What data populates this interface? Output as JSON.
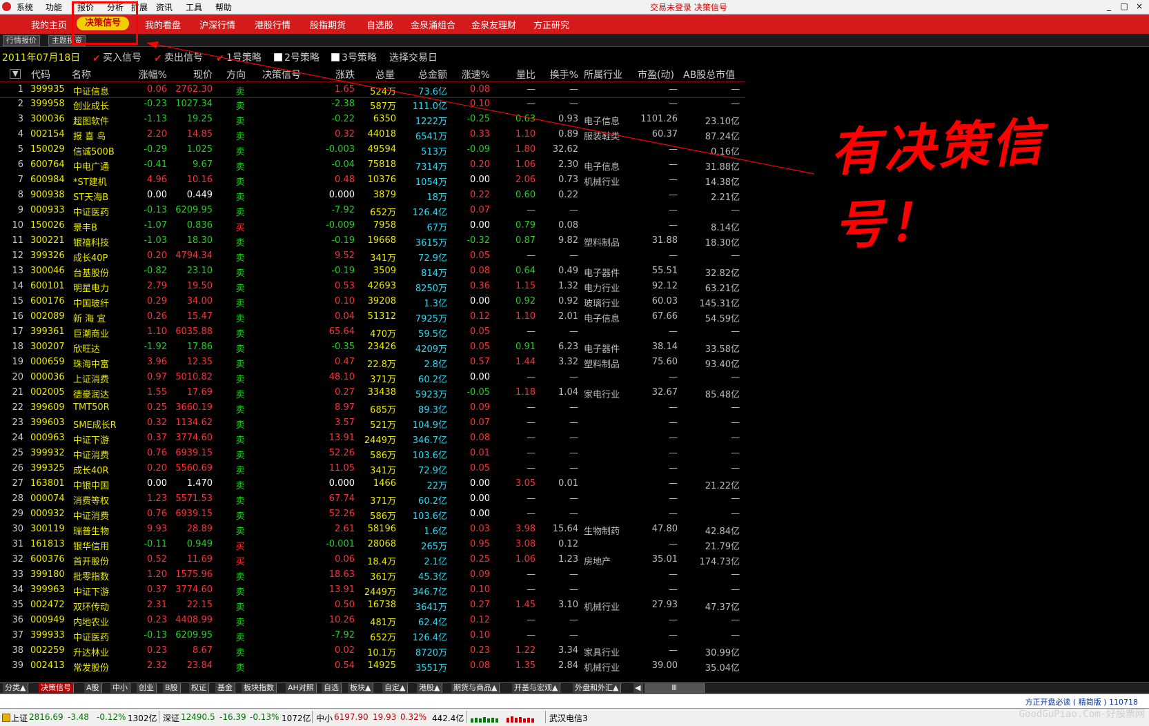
{
  "menubar": {
    "items": [
      "系统",
      "功能",
      "报价",
      "分析",
      "扩展",
      "资讯",
      "工具",
      "帮助"
    ],
    "status": "交易未登录  决策信号",
    "win_buttons": [
      "_",
      "□",
      "×"
    ]
  },
  "navbar": {
    "items": [
      "我的主页",
      "决策信号",
      "我的看盘",
      "沪深行情",
      "港股行情",
      "股指期货",
      "自选股",
      "金泉涌组合",
      "金泉友理财",
      "方正研究"
    ],
    "active_index": 1
  },
  "subtabs": [
    "行情报价",
    "主题投资"
  ],
  "filter": {
    "date": "2011年07月18日",
    "options": [
      {
        "label": "买入信号",
        "checked": true
      },
      {
        "label": "卖出信号",
        "checked": true
      },
      {
        "label": "1号策略",
        "checked": true
      },
      {
        "label": "2号策略",
        "checked": false
      },
      {
        "label": "3号策略",
        "checked": false
      }
    ],
    "select_day": "选择交易日"
  },
  "table": {
    "headers": [
      "代码",
      "名称",
      "涨幅%",
      "现价",
      "方向",
      "决策信号",
      "涨跌",
      "总量",
      "总金额",
      "涨速%",
      "量比",
      "换手%",
      "所属行业",
      "市盈(动)",
      "AB股总市值"
    ],
    "sort_icon": "▼",
    "rows": [
      [
        "1",
        "399935",
        "中证信息",
        "0.06",
        "2762.30",
        "卖",
        "",
        "1.65",
        "524万",
        "73.6亿",
        "0.08",
        "—",
        "—",
        "",
        "—",
        "—"
      ],
      [
        "2",
        "399958",
        "创业成长",
        "-0.23",
        "1027.34",
        "卖",
        "",
        "-2.38",
        "587万",
        "111.0亿",
        "0.10",
        "—",
        "—",
        "",
        "—",
        "—"
      ],
      [
        "3",
        "300036",
        "超图软件",
        "-1.13",
        "19.25",
        "卖",
        "",
        "-0.22",
        "6350",
        "1222万",
        "-0.25",
        "0.63",
        "0.93",
        "电子信息",
        "1101.26",
        "23.10亿"
      ],
      [
        "4",
        "002154",
        "报 喜 鸟",
        "2.20",
        "14.85",
        "卖",
        "",
        "0.32",
        "44018",
        "6541万",
        "0.33",
        "1.10",
        "0.89",
        "服装鞋类",
        "60.37",
        "87.24亿"
      ],
      [
        "5",
        "150029",
        "信诚500B",
        "-0.29",
        "1.025",
        "卖",
        "",
        "-0.003",
        "49594",
        "513万",
        "-0.09",
        "1.80",
        "32.62",
        "",
        "—",
        "0.16亿"
      ],
      [
        "6",
        "600764",
        "中电广通",
        "-0.41",
        "9.67",
        "卖",
        "",
        "-0.04",
        "75818",
        "7314万",
        "0.20",
        "1.06",
        "2.30",
        "电子信息",
        "—",
        "31.88亿"
      ],
      [
        "7",
        "600984",
        "*ST建机",
        "4.96",
        "10.16",
        "卖",
        "",
        "0.48",
        "10376",
        "1054万",
        "0.00",
        "2.06",
        "0.73",
        "机械行业",
        "—",
        "14.38亿"
      ],
      [
        "8",
        "900938",
        "ST天海B",
        "0.00",
        "0.449",
        "卖",
        "",
        "0.000",
        "3879",
        "18万",
        "0.22",
        "0.60",
        "0.22",
        "",
        "—",
        "2.21亿"
      ],
      [
        "9",
        "000933",
        "中证医药",
        "-0.13",
        "6209.95",
        "卖",
        "",
        "-7.92",
        "652万",
        "126.4亿",
        "0.07",
        "—",
        "—",
        "",
        "—",
        "—"
      ],
      [
        "10",
        "150026",
        "景丰B",
        "-1.07",
        "0.836",
        "买",
        "",
        "-0.009",
        "7958",
        "67万",
        "0.00",
        "0.79",
        "0.08",
        "",
        "—",
        "8.14亿"
      ],
      [
        "11",
        "300221",
        "银禧科技",
        "-1.03",
        "18.30",
        "卖",
        "",
        "-0.19",
        "19668",
        "3615万",
        "-0.32",
        "0.87",
        "9.82",
        "塑料制品",
        "31.88",
        "18.30亿"
      ],
      [
        "12",
        "399326",
        "成长40P",
        "0.20",
        "4794.34",
        "卖",
        "",
        "9.52",
        "341万",
        "72.9亿",
        "0.05",
        "—",
        "—",
        "",
        "—",
        "—"
      ],
      [
        "13",
        "300046",
        "台基股份",
        "-0.82",
        "23.10",
        "卖",
        "",
        "-0.19",
        "3509",
        "814万",
        "0.08",
        "0.64",
        "0.49",
        "电子器件",
        "55.51",
        "32.82亿"
      ],
      [
        "14",
        "600101",
        "明星电力",
        "2.79",
        "19.50",
        "卖",
        "",
        "0.53",
        "42693",
        "8250万",
        "0.36",
        "1.15",
        "1.32",
        "电力行业",
        "92.12",
        "63.21亿"
      ],
      [
        "15",
        "600176",
        "中国玻纤",
        "0.29",
        "34.00",
        "卖",
        "",
        "0.10",
        "39208",
        "1.3亿",
        "0.00",
        "0.92",
        "0.92",
        "玻璃行业",
        "60.03",
        "145.31亿"
      ],
      [
        "16",
        "002089",
        "新 海 宜",
        "0.26",
        "15.47",
        "卖",
        "",
        "0.04",
        "51312",
        "7925万",
        "0.12",
        "1.10",
        "2.01",
        "电子信息",
        "67.66",
        "54.59亿"
      ],
      [
        "17",
        "399361",
        "巨潮商业",
        "1.10",
        "6035.88",
        "卖",
        "",
        "65.64",
        "470万",
        "59.5亿",
        "0.05",
        "—",
        "—",
        "",
        "—",
        "—"
      ],
      [
        "18",
        "300207",
        "欣旺达",
        "-1.92",
        "17.86",
        "卖",
        "",
        "-0.35",
        "23426",
        "4209万",
        "0.05",
        "0.91",
        "6.23",
        "电子器件",
        "38.14",
        "33.58亿"
      ],
      [
        "19",
        "000659",
        "珠海中富",
        "3.96",
        "12.35",
        "卖",
        "",
        "0.47",
        "22.8万",
        "2.8亿",
        "0.57",
        "1.44",
        "3.32",
        "塑料制品",
        "75.60",
        "93.40亿"
      ],
      [
        "20",
        "000036",
        "上证消费",
        "0.97",
        "5010.82",
        "卖",
        "",
        "48.10",
        "371万",
        "60.2亿",
        "0.00",
        "—",
        "—",
        "",
        "—",
        "—"
      ],
      [
        "21",
        "002005",
        "德豪润达",
        "1.55",
        "17.69",
        "卖",
        "",
        "0.27",
        "33438",
        "5923万",
        "-0.05",
        "1.18",
        "1.04",
        "家电行业",
        "32.67",
        "85.48亿"
      ],
      [
        "22",
        "399609",
        "TMT50R",
        "0.25",
        "3660.19",
        "卖",
        "",
        "8.97",
        "685万",
        "89.3亿",
        "0.09",
        "—",
        "—",
        "",
        "—",
        "—"
      ],
      [
        "23",
        "399603",
        "SME成长R",
        "0.32",
        "1134.62",
        "卖",
        "",
        "3.57",
        "521万",
        "104.9亿",
        "0.07",
        "—",
        "—",
        "",
        "—",
        "—"
      ],
      [
        "24",
        "000963",
        "中证下游",
        "0.37",
        "3774.60",
        "卖",
        "",
        "13.91",
        "2449万",
        "346.7亿",
        "0.08",
        "—",
        "—",
        "",
        "—",
        "—"
      ],
      [
        "25",
        "399932",
        "中证消费",
        "0.76",
        "6939.15",
        "卖",
        "",
        "52.26",
        "586万",
        "103.6亿",
        "0.01",
        "—",
        "—",
        "",
        "—",
        "—"
      ],
      [
        "26",
        "399325",
        "成长40R",
        "0.20",
        "5560.69",
        "卖",
        "",
        "11.05",
        "341万",
        "72.9亿",
        "0.05",
        "—",
        "—",
        "",
        "—",
        "—"
      ],
      [
        "27",
        "163801",
        "中银中国",
        "0.00",
        "1.470",
        "卖",
        "",
        "0.000",
        "1466",
        "22万",
        "0.00",
        "3.05",
        "0.01",
        "",
        "—",
        "21.22亿"
      ],
      [
        "28",
        "000074",
        "消费等权",
        "1.23",
        "5571.53",
        "卖",
        "",
        "67.74",
        "371万",
        "60.2亿",
        "0.00",
        "—",
        "—",
        "",
        "—",
        "—"
      ],
      [
        "29",
        "000932",
        "中证消费",
        "0.76",
        "6939.15",
        "卖",
        "",
        "52.26",
        "586万",
        "103.6亿",
        "0.00",
        "—",
        "—",
        "",
        "—",
        "—"
      ],
      [
        "30",
        "300119",
        "瑞普生物",
        "9.93",
        "28.89",
        "卖",
        "",
        "2.61",
        "58196",
        "1.6亿",
        "0.03",
        "3.98",
        "15.64",
        "生物制药",
        "47.80",
        "42.84亿"
      ],
      [
        "31",
        "161813",
        "银华信用",
        "-0.11",
        "0.949",
        "买",
        "",
        "-0.001",
        "28068",
        "265万",
        "0.95",
        "3.08",
        "0.12",
        "",
        "—",
        "21.79亿"
      ],
      [
        "32",
        "600376",
        "首开股份",
        "0.52",
        "11.69",
        "买",
        "",
        "0.06",
        "18.4万",
        "2.1亿",
        "0.25",
        "1.06",
        "1.23",
        "房地产",
        "35.01",
        "174.73亿"
      ],
      [
        "33",
        "399180",
        "批零指数",
        "1.20",
        "1575.96",
        "卖",
        "",
        "18.63",
        "361万",
        "45.3亿",
        "0.09",
        "—",
        "—",
        "",
        "—",
        "—"
      ],
      [
        "34",
        "399963",
        "中证下游",
        "0.37",
        "3774.60",
        "卖",
        "",
        "13.91",
        "2449万",
        "346.7亿",
        "0.10",
        "—",
        "—",
        "",
        "—",
        "—"
      ],
      [
        "35",
        "002472",
        "双环传动",
        "2.31",
        "22.15",
        "卖",
        "",
        "0.50",
        "16738",
        "3641万",
        "0.27",
        "1.45",
        "3.10",
        "机械行业",
        "27.93",
        "47.37亿"
      ],
      [
        "36",
        "000949",
        "内地农业",
        "0.23",
        "4408.99",
        "卖",
        "",
        "10.26",
        "481万",
        "62.4亿",
        "0.12",
        "—",
        "—",
        "",
        "—",
        "—"
      ],
      [
        "37",
        "399933",
        "中证医药",
        "-0.13",
        "6209.95",
        "卖",
        "",
        "-7.92",
        "652万",
        "126.4亿",
        "0.10",
        "—",
        "—",
        "",
        "—",
        "—"
      ],
      [
        "38",
        "002259",
        "升达林业",
        "0.23",
        "8.67",
        "卖",
        "",
        "0.02",
        "10.1万",
        "8720万",
        "0.23",
        "1.22",
        "3.34",
        "家具行业",
        "—",
        "30.99亿"
      ],
      [
        "39",
        "002413",
        "常发股份",
        "2.32",
        "23.84",
        "卖",
        "",
        "0.54",
        "14925",
        "3551万",
        "0.08",
        "1.35",
        "2.84",
        "机械行业",
        "39.00",
        "35.04亿"
      ]
    ]
  },
  "bottom_tabs": [
    "分类▲",
    "决策信号",
    "A股",
    "中小",
    "创业",
    "B股",
    "权证",
    "基金",
    "板块指数",
    "AH对照",
    "自选",
    "板块▲",
    "自定▲",
    "港股▲",
    "期货与商品▲",
    "开基与宏观▲",
    "外盘和外汇▲"
  ],
  "bottom_tabs_active": 1,
  "scroll_arrow": "◀",
  "scroll_grip": "Ⅲ",
  "infoline": {
    "news": "方正开盘必读 ( 精简版 ) 110718"
  },
  "statusbar": {
    "sh_label": "上证",
    "sh_value": "2816.69",
    "sh_change": "-3.48",
    "sh_pct": "-0.12%",
    "sh_amount": "1302亿",
    "sz_label": "深证",
    "sz_value": "12490.5",
    "sz_change": "-16.39",
    "sz_pct": "-0.13%",
    "sz_amount": "1072亿",
    "zx_label": "中小",
    "zx_value": "6197.90",
    "zx_change": "19.93",
    "zx_pct": "0.32%",
    "zx_amount": "442.4亿",
    "broker": "武汉电信3"
  },
  "watermark": "GoodGuPiao.Com-好股票网",
  "annotation": {
    "text": "有决策信号！",
    "color": "#ff0000"
  }
}
